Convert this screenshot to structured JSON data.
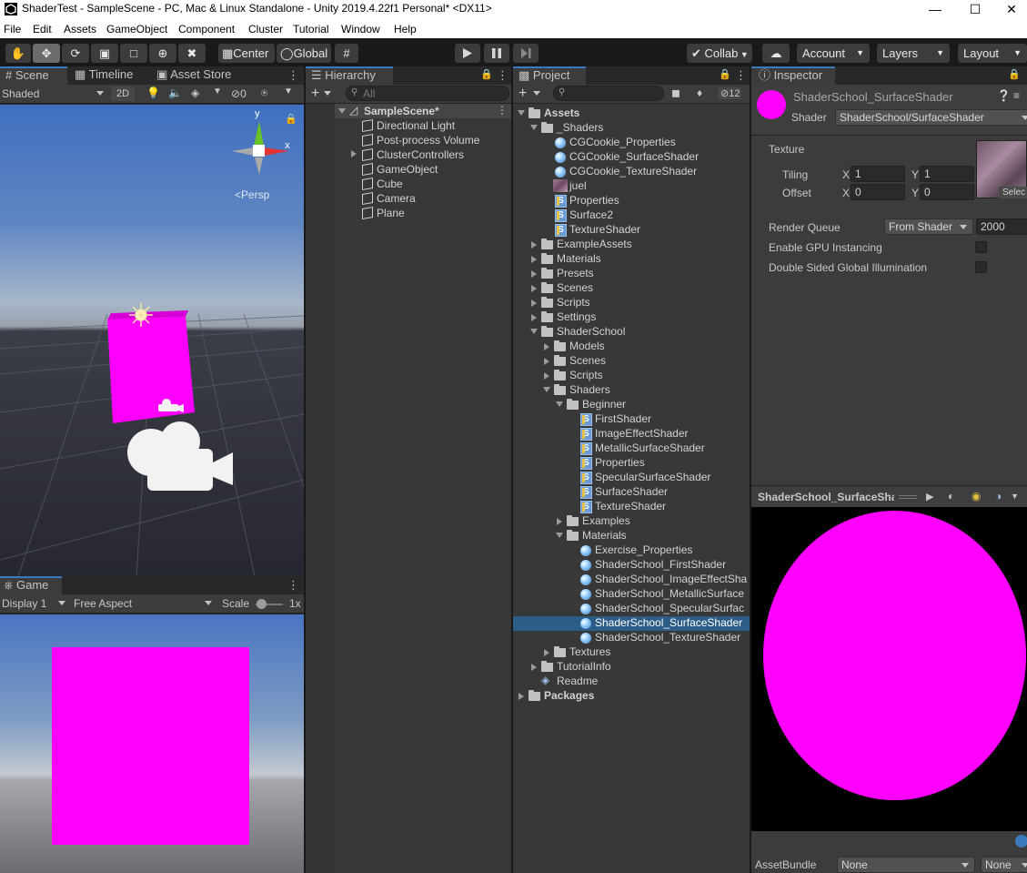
{
  "window": {
    "title": "ShaderTest - SampleScene - PC, Mac & Linux Standalone - Unity 2019.4.22f1 Personal* <DX11>"
  },
  "menu": [
    "File",
    "Edit",
    "Assets",
    "GameObject",
    "Component",
    "Cluster",
    "Tutorial",
    "Window",
    "Help"
  ],
  "toolbar": {
    "pivot": "Center",
    "space": "Global",
    "collab": "Collab",
    "account": "Account",
    "layers": "Layers",
    "layout": "Layout"
  },
  "scene": {
    "tabs": [
      "Scene",
      "Timeline",
      "Asset Store"
    ],
    "shading": "Shaded",
    "mode2d": "2D",
    "hidden_count": "0",
    "persp": "<Persp",
    "gizmo_y": "y",
    "gizmo_x": "x"
  },
  "game": {
    "tab": "Game",
    "display": "Display 1",
    "aspect": "Free Aspect",
    "scale_label": "Scale",
    "scale_value": "1x"
  },
  "hierarchy": {
    "tab": "Hierarchy",
    "search_placeholder": "All",
    "scene": "SampleScene*",
    "items": [
      "Directional Light",
      "Post-process Volume",
      "ClusterControllers",
      "GameObject",
      "Cube",
      "Camera",
      "Plane"
    ]
  },
  "project": {
    "tab": "Project",
    "hidden_count": "12",
    "tree": {
      "assets": "Assets",
      "shaders_folder": "_Shaders",
      "cgc_props": "CGCookie_Properties",
      "cgc_surface": "CGCookie_SurfaceShader",
      "cgc_texture": "CGCookie_TextureShader",
      "juel": "juel",
      "properties": "Properties",
      "surface2": "Surface2",
      "textureshader": "TextureShader",
      "example_assets": "ExampleAssets",
      "materials": "Materials",
      "presets": "Presets",
      "scenes": "Scenes",
      "scripts": "Scripts",
      "settings": "Settings",
      "shaderschool": "ShaderSchool",
      "ss_models": "Models",
      "ss_scenes": "Scenes",
      "ss_scripts": "Scripts",
      "ss_shaders": "Shaders",
      "beginner": "Beginner",
      "beginner_items": [
        "FirstShader",
        "ImageEffectShader",
        "MetallicSurfaceShader",
        "Properties",
        "SpecularSurfaceShader",
        "SurfaceShader",
        "TextureShader"
      ],
      "examples": "Examples",
      "ss_materials": "Materials",
      "material_items": [
        "Exercise_Properties",
        "ShaderSchool_FirstShader",
        "ShaderSchool_ImageEffectSha",
        "ShaderSchool_MetallicSurface",
        "ShaderSchool_SpecularSurfac",
        "ShaderSchool_SurfaceShader",
        "ShaderSchool_TextureShader"
      ],
      "textures": "Textures",
      "tutorialinfo": "TutorialInfo",
      "readme": "Readme",
      "packages": "Packages"
    }
  },
  "inspector": {
    "tab": "Inspector",
    "material_name": "ShaderSchool_SurfaceShader",
    "shader_label": "Shader",
    "shader_value": "ShaderSchool/SurfaceShader",
    "texture_label": "Texture",
    "tiling_label": "Tiling",
    "offset_label": "Offset",
    "x": "X",
    "y": "Y",
    "tiling_x": "1",
    "tiling_y": "1",
    "offset_x": "0",
    "offset_y": "0",
    "select": "Selec",
    "render_queue_label": "Render Queue",
    "render_queue_mode": "From Shader",
    "render_queue_value": "2000",
    "gpu_instancing": "Enable GPU Instancing",
    "double_sided_gi": "Double Sided Global Illumination",
    "preview_title": "ShaderSchool_SurfaceSha",
    "assetbundle_label": "AssetBundle",
    "assetbundle_value": "None",
    "assetbundle_variant": "None"
  },
  "colors": {
    "magenta": "#ff00ff",
    "selection": "#2c5d87",
    "accent": "#3a79bb"
  }
}
